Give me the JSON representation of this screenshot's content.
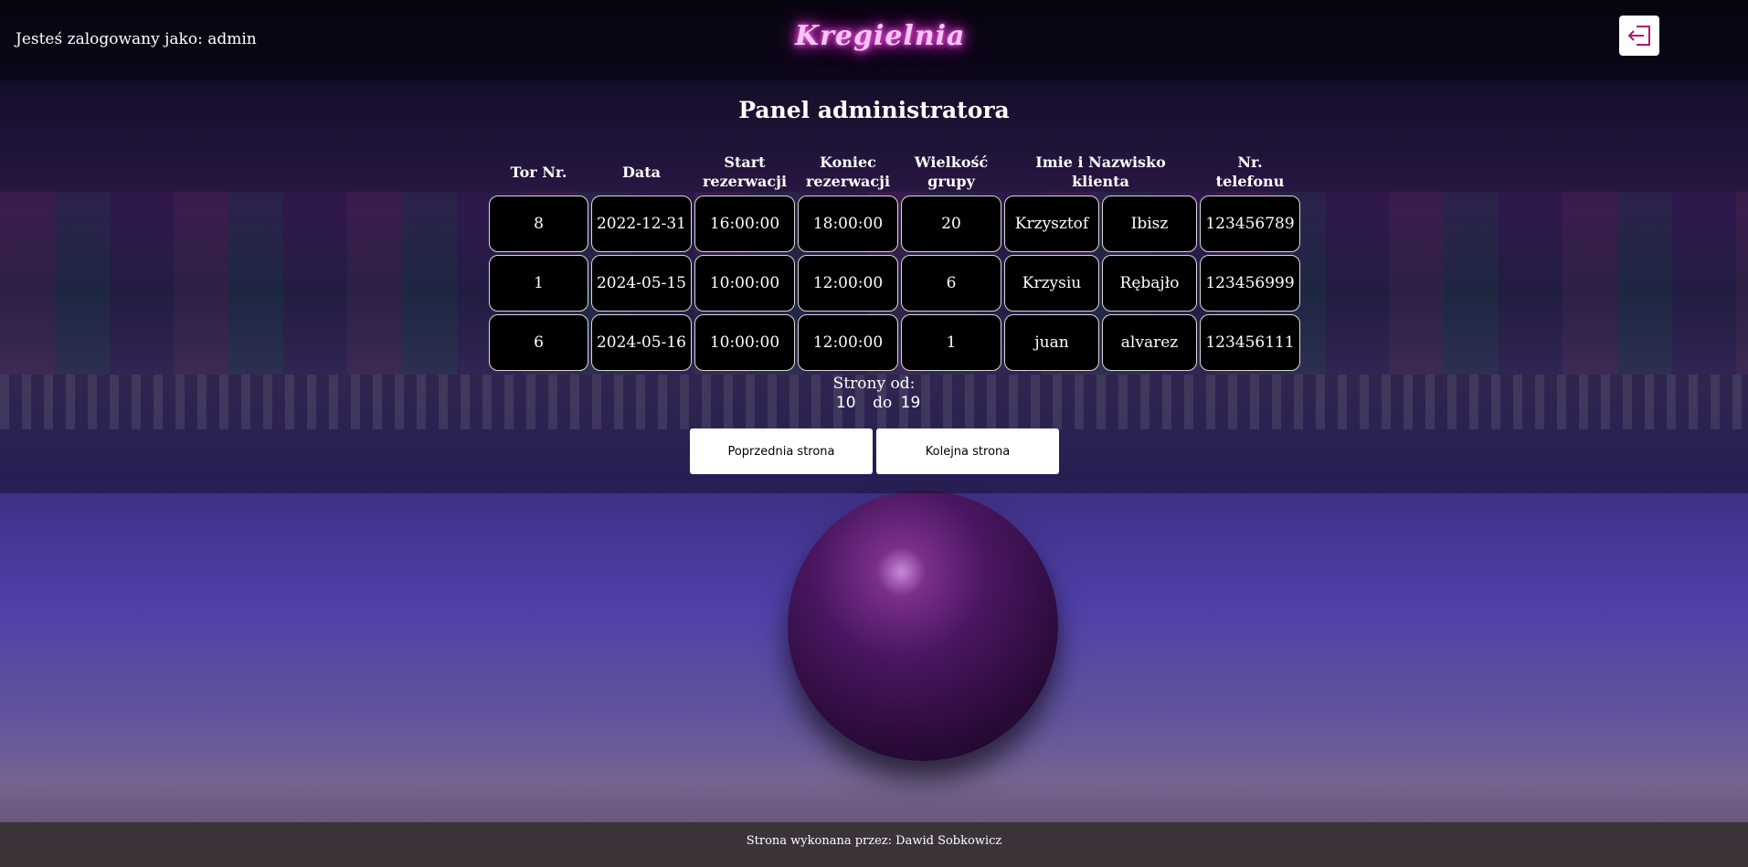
{
  "header": {
    "login_text": "Jesteś zalogowany jako: admin",
    "logo_text": "Kregielnia",
    "logout_icon": "logout-icon"
  },
  "main": {
    "title": "Panel administratora",
    "table": {
      "headers": [
        "Tor Nr.",
        "Data",
        "Start rezerwacji",
        "Koniec rezerwacji",
        "Wielkość grupy",
        "Imie i Nazwisko klienta",
        "",
        "Nr. telefonu"
      ],
      "rows": [
        [
          "8",
          "2022-12-31",
          "16:00:00",
          "18:00:00",
          "20",
          "Krzysztof",
          "Ibisz",
          "123456789"
        ],
        [
          "1",
          "2024-05-15",
          "10:00:00",
          "12:00:00",
          "6",
          "Krzysiu",
          "Rębajło",
          "123456999"
        ],
        [
          "6",
          "2024-05-16",
          "10:00:00",
          "12:00:00",
          "1",
          "juan",
          "alvarez",
          "123456111"
        ]
      ]
    },
    "pagination": {
      "label": "Strony od:",
      "from": "10",
      "to_label": "do",
      "to": "19",
      "prev_label": "Poprzednia strona",
      "next_label": "Kolejna strona"
    }
  },
  "footer": {
    "text": "Strona wykonana przez: Dawid Sobkowicz"
  }
}
